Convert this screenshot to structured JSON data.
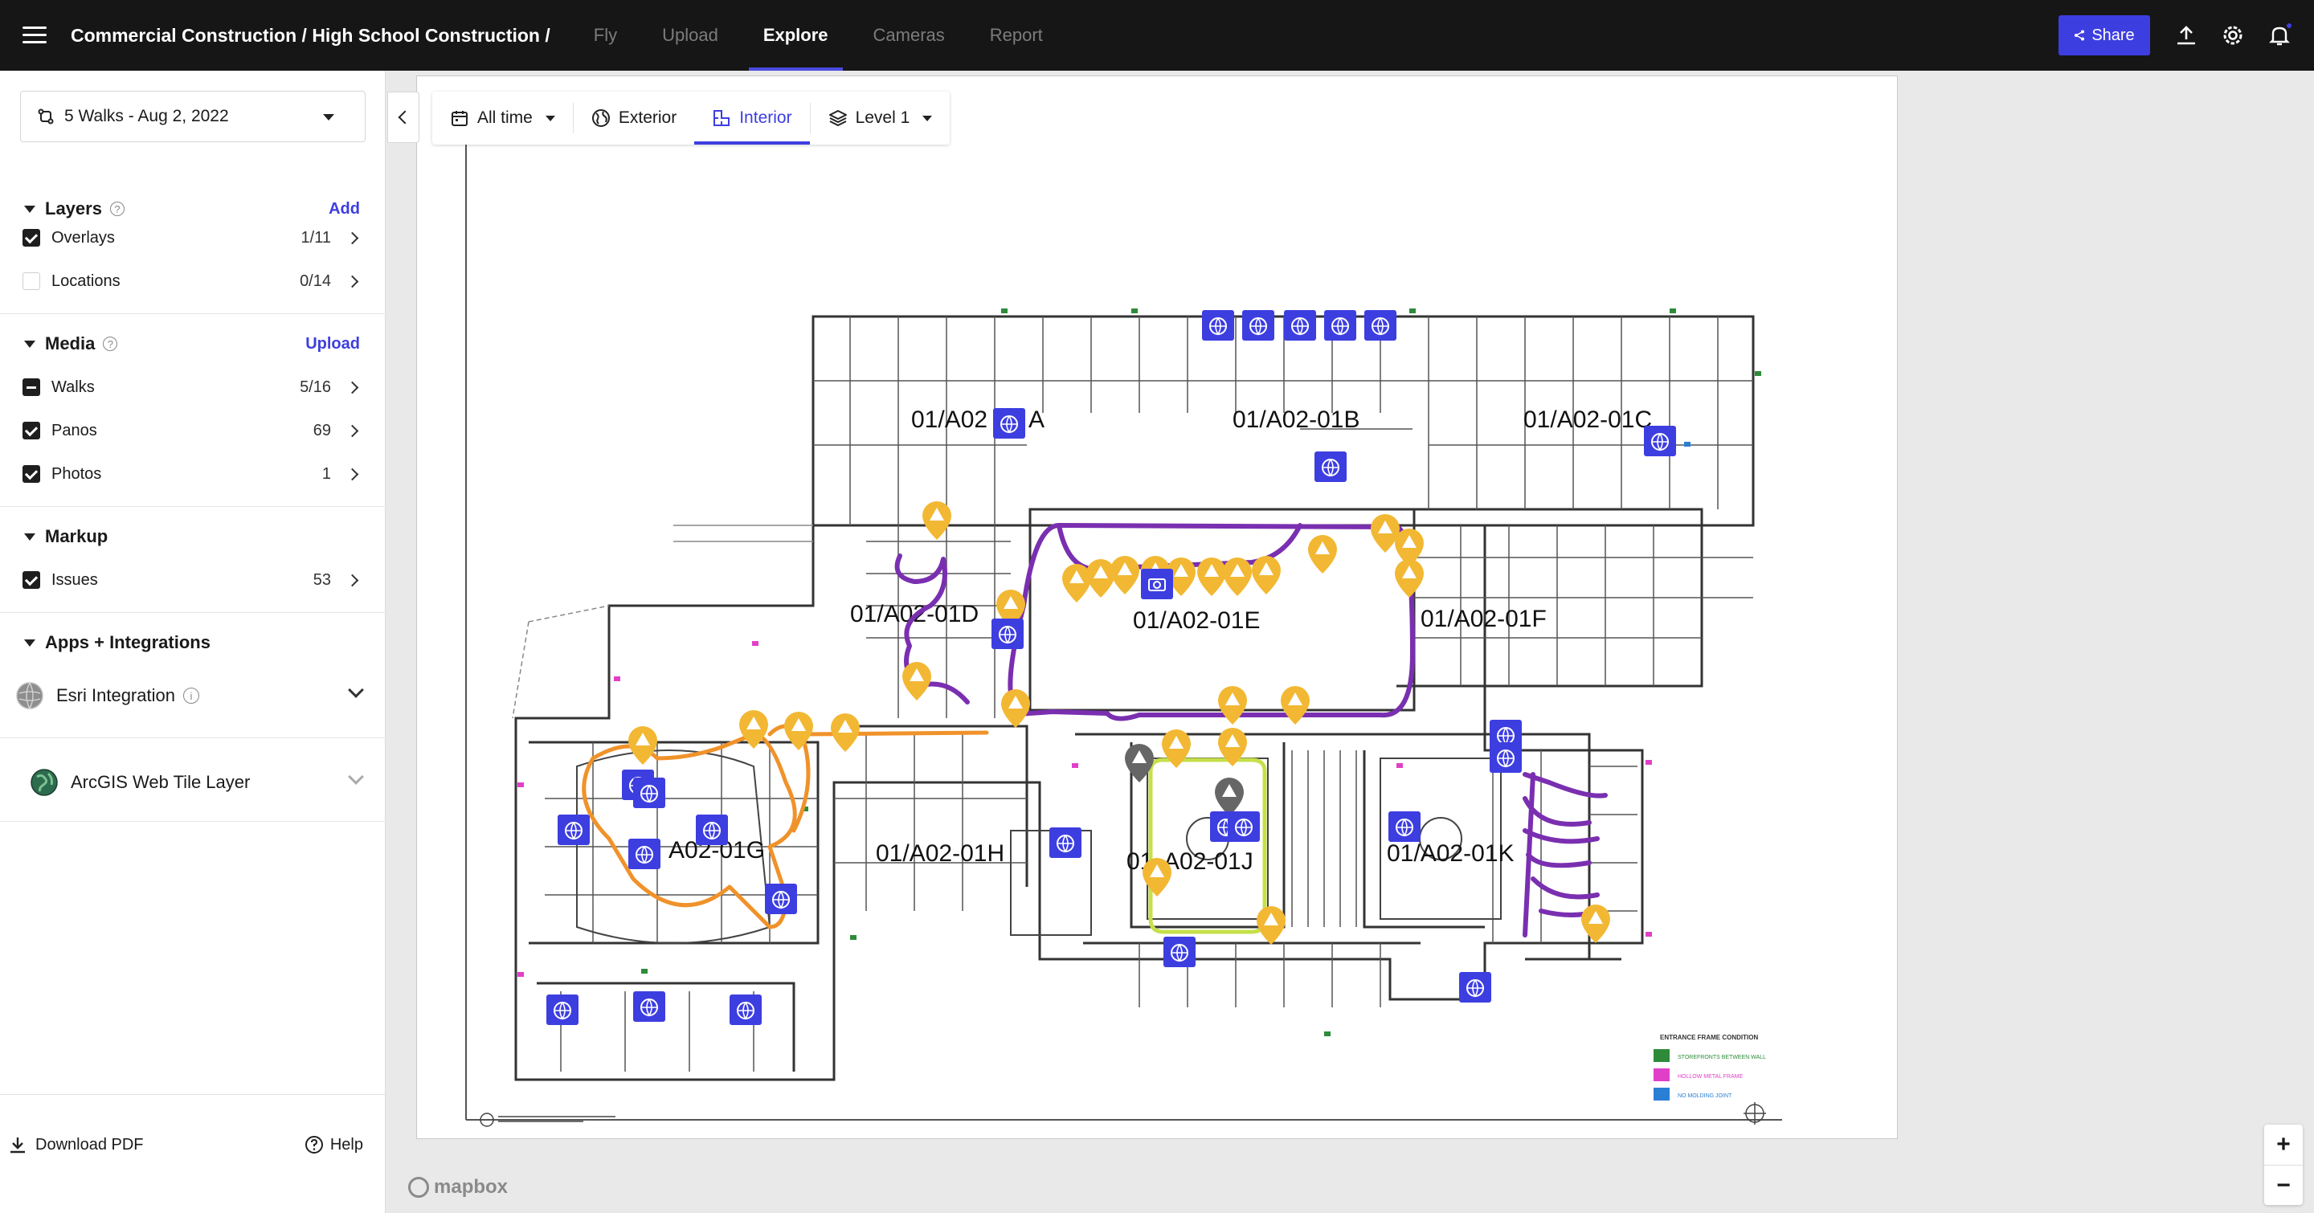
{
  "topbar": {
    "breadcrumb": "Commercial Construction / High School Construction /",
    "tabs": [
      {
        "label": "Fly",
        "active": false
      },
      {
        "label": "Upload",
        "active": false
      },
      {
        "label": "Explore",
        "active": true
      },
      {
        "label": "Cameras",
        "active": false
      },
      {
        "label": "Report",
        "active": false
      }
    ],
    "share_label": "Share",
    "icons": [
      "upload-icon",
      "gear-icon",
      "bell-icon"
    ]
  },
  "sidebar": {
    "walk_select": "5 Walks - Aug 2, 2022",
    "layers": {
      "title": "Layers",
      "action": "Add",
      "items": [
        {
          "label": "Overlays",
          "count": "1/11",
          "state": "checked"
        },
        {
          "label": "Locations",
          "count": "0/14",
          "state": "empty"
        }
      ]
    },
    "media": {
      "title": "Media",
      "action": "Upload",
      "items": [
        {
          "label": "Walks",
          "count": "5/16",
          "state": "partial"
        },
        {
          "label": "Panos",
          "count": "69",
          "state": "checked"
        },
        {
          "label": "Photos",
          "count": "1",
          "state": "checked"
        }
      ]
    },
    "markup": {
      "title": "Markup",
      "items": [
        {
          "label": "Issues",
          "count": "53",
          "state": "checked"
        }
      ]
    },
    "apps": {
      "title": "Apps + Integrations",
      "items": [
        {
          "label": "Esri Integration"
        },
        {
          "label": "ArcGIS Web Tile Layer"
        }
      ]
    },
    "footer": {
      "download_label": "Download PDF",
      "help_label": "Help"
    }
  },
  "map_toolbar": {
    "time": "All time",
    "exterior": "Exterior",
    "interior": "Interior",
    "level": "Level 1"
  },
  "map": {
    "zone_labels": [
      "01/A02",
      "A",
      "01/A02-01B",
      "01/A02-01C",
      "01/A02-01D",
      "01/A02-01E",
      "01/A02-01F",
      "A02-01G",
      "01/A02-01H",
      "01",
      "A02-01J",
      "01/A02-01K"
    ],
    "legend_title": "ENTRANCE FRAME CONDITION",
    "legend_items": [
      {
        "label": "STOREFRONTS BETWEEN WALL",
        "color": "#2e8b3a"
      },
      {
        "label": "HOLLOW METAL FRAME",
        "color": "#e040c8"
      },
      {
        "label": "NO MOLDING JOINT",
        "color": "#2a7fd4"
      }
    ],
    "colors": {
      "pano_pin": "#3d3ee0",
      "issue_pin": "#f2b833",
      "walk_purple": "#7a2fb0",
      "walk_orange": "#f0922a",
      "walk_green": "#c6e04a"
    },
    "attribution": "mapbox"
  },
  "zoom": {
    "in": "+",
    "out": "−"
  }
}
